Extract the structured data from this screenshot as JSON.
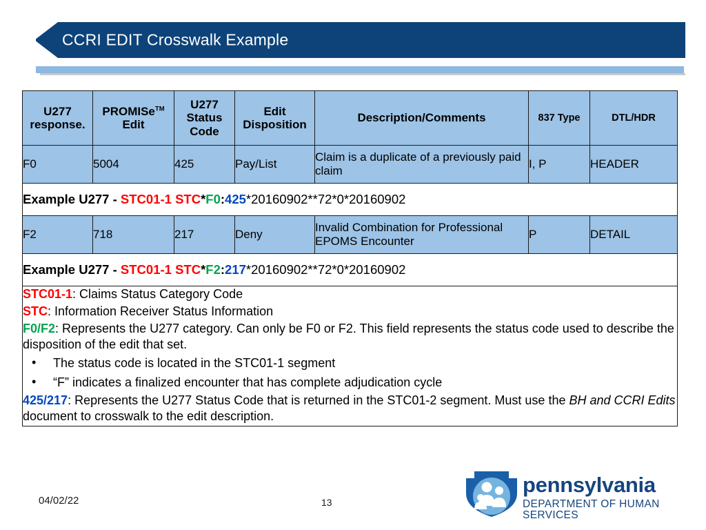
{
  "slide": {
    "title": "CCRI EDIT Crosswalk Example",
    "footer_date": "04/02/22",
    "slide_number": "13"
  },
  "colors": {
    "banner": "#0D4379",
    "banner_underline": "#8DB8DF",
    "table_fill": "#9DC3E6",
    "red": "#FF0000",
    "green": "#00A550",
    "blue": "#0047C0",
    "logo_blue": "#16457E"
  },
  "table": {
    "headers": [
      "U277 response.",
      "PROMISe",
      "U277 Status Code",
      "Edit Disposition",
      "Description/Comments",
      "837 Type",
      "DTL/HDR"
    ],
    "header_promise_sup": "TM",
    "header_promise_line2": "Edit",
    "rows": [
      {
        "u277_response": "F0",
        "promise_edit": "5004",
        "status_code": "425",
        "edit_disposition": "Pay/List",
        "description": "Claim is a duplicate of a previously paid claim",
        "type_837": "I, P",
        "dtl_hdr": "HEADER"
      },
      {
        "u277_response": "F2",
        "promise_edit": "718",
        "status_code": "217",
        "edit_disposition": "Deny",
        "description": "Invalid Combination for Professional EPOMS Encounter",
        "type_837": "P",
        "dtl_hdr": "DETAIL"
      }
    ],
    "examples": [
      {
        "label": "Example U277 - ",
        "segment": "STC01-1 STC",
        "sep1": "*",
        "category": "F0",
        "sep2": ":",
        "status": "425",
        "tail": "*20160902**72*0*20160902"
      },
      {
        "label": "Example U277 - ",
        "segment": "STC01-1 STC",
        "sep1": "*",
        "category": "F2",
        "sep2": ":",
        "status": "217",
        "tail": "*20160902**72*0*20160902"
      }
    ],
    "legend": {
      "line1_key": "STC01-1",
      "line1_text": ": Claims Status Category Code",
      "line2_key": "STC",
      "line2_text": ": Information Receiver Status Information",
      "line3_key": "F0/F2",
      "line3_text": ": Represents the U277 category. Can only be F0 or F2. This field represents the status code used to describe the disposition of the edit that set.",
      "bullet1": "The status code is located in the STC01-1 segment",
      "bullet2": "“F” indicates a finalized encounter that has complete adjudication cycle",
      "bullet_glyph": "•",
      "line4_key": "425/217",
      "line4_text_a": ": Represents the U277 Status Code that is returned in the STC01-2 segment. Must use the ",
      "line4_italic": "BH and CCRI Edits",
      "line4_text_b": " document to crosswalk to the edit description."
    }
  },
  "logo": {
    "name": "pennsylvania",
    "department": "DEPARTMENT OF HUMAN SERVICES"
  }
}
